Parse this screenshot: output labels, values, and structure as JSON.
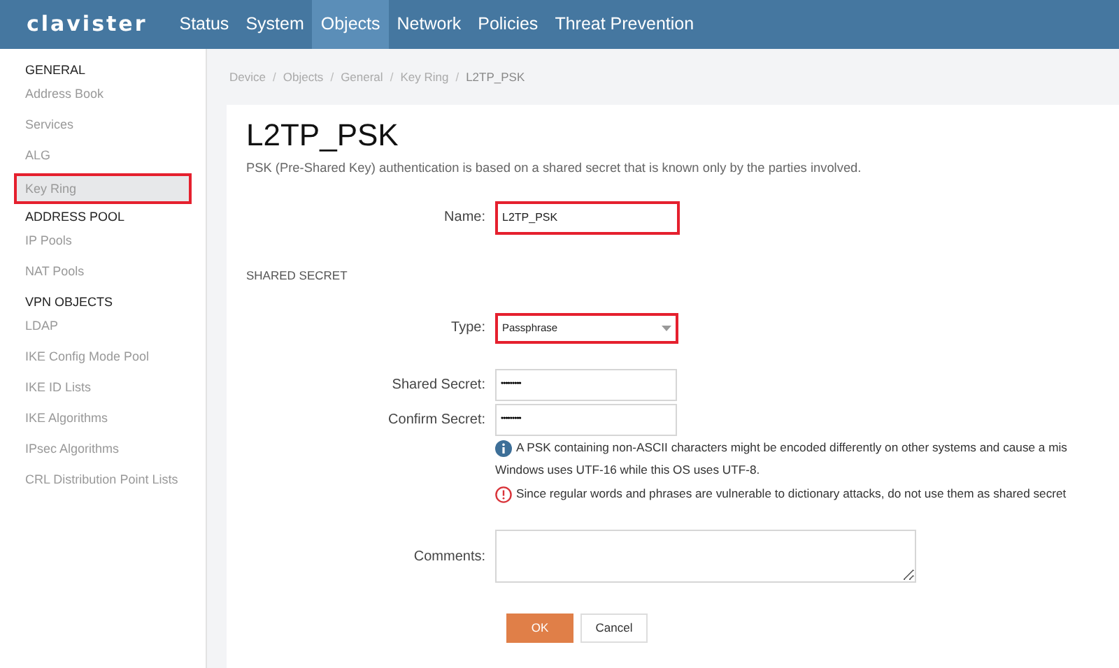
{
  "header": {
    "logo": "clavister",
    "nav": [
      {
        "label": "Status",
        "selected": false
      },
      {
        "label": "System",
        "selected": false
      },
      {
        "label": "Objects",
        "selected": true
      },
      {
        "label": "Network",
        "selected": false
      },
      {
        "label": "Policies",
        "selected": false
      },
      {
        "label": "Threat Prevention",
        "selected": false
      }
    ]
  },
  "sidebar": {
    "sections": [
      {
        "title": "GENERAL",
        "items": [
          {
            "label": "Address Book",
            "selected": false,
            "highlighted": false
          },
          {
            "label": "Services",
            "selected": false,
            "highlighted": false
          },
          {
            "label": "ALG",
            "selected": false,
            "highlighted": false
          },
          {
            "label": "Key Ring",
            "selected": true,
            "highlighted": true
          }
        ]
      },
      {
        "title": "ADDRESS POOL",
        "items": [
          {
            "label": "IP Pools",
            "selected": false,
            "highlighted": false
          },
          {
            "label": "NAT Pools",
            "selected": false,
            "highlighted": false
          }
        ]
      },
      {
        "title": "VPN OBJECTS",
        "items": [
          {
            "label": "LDAP",
            "selected": false,
            "highlighted": false
          },
          {
            "label": "IKE Config Mode Pool",
            "selected": false,
            "highlighted": false
          },
          {
            "label": "IKE ID Lists",
            "selected": false,
            "highlighted": false
          },
          {
            "label": "IKE Algorithms",
            "selected": false,
            "highlighted": false
          },
          {
            "label": "IPsec Algorithms",
            "selected": false,
            "highlighted": false
          },
          {
            "label": "CRL Distribution Point Lists",
            "selected": false,
            "highlighted": false
          }
        ]
      }
    ]
  },
  "breadcrumb": [
    {
      "kind": "link",
      "text": "Device"
    },
    {
      "kind": "separator",
      "text": "/"
    },
    {
      "kind": "link",
      "text": "Objects"
    },
    {
      "kind": "separator",
      "text": "/"
    },
    {
      "kind": "link",
      "text": "General"
    },
    {
      "kind": "separator",
      "text": "/"
    },
    {
      "kind": "link",
      "text": "Key Ring"
    },
    {
      "kind": "separator",
      "text": "/"
    },
    {
      "kind": "current",
      "text": "L2TP_PSK"
    }
  ],
  "page": {
    "title": "L2TP_PSK",
    "description": "PSK (Pre-Shared Key) authentication is based on a shared secret that is known only by the parties involved.",
    "name_field": {
      "label": "Name:",
      "value": "L2TP_PSK",
      "highlighted": true
    },
    "section_title": "SHARED SECRET",
    "type_field": {
      "label": "Type:",
      "value": "Passphrase",
      "highlighted": true
    },
    "secret_fields": [
      {
        "label": "Shared Secret:",
        "value": "•••••••••"
      },
      {
        "label": "Confirm Secret:",
        "value": "•••••••••"
      }
    ],
    "messages": [
      {
        "kind": "info",
        "lines": [
          "A PSK containing non-ASCII characters might be encoded differently on other systems and cause a mis",
          "Windows uses UTF-16 while this OS uses UTF-8."
        ]
      },
      {
        "kind": "warning",
        "lines": [
          "Since regular words and phrases are vulnerable to dictionary attacks, do not use them as shared secret"
        ]
      }
    ],
    "comments": {
      "label": "Comments:"
    },
    "buttons": [
      {
        "label": "OK",
        "kind": "primary"
      },
      {
        "label": "Cancel",
        "kind": "secondary"
      }
    ]
  }
}
